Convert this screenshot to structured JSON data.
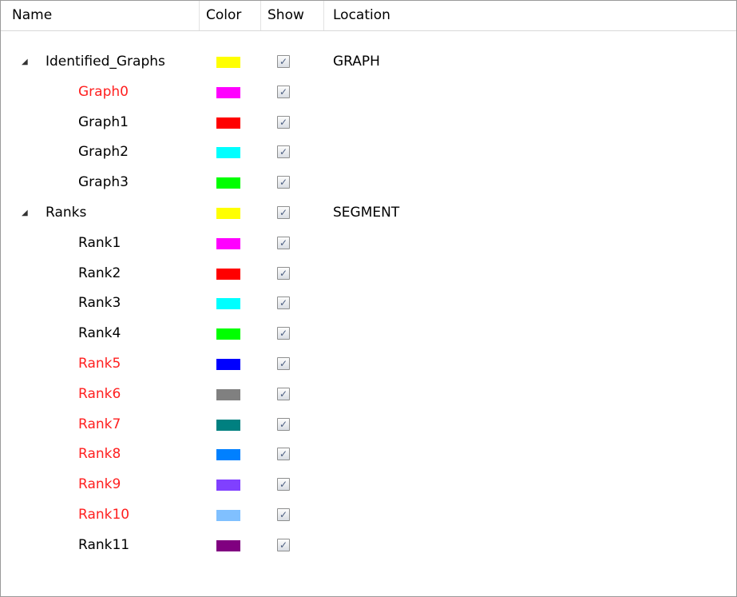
{
  "columns": {
    "name": "Name",
    "color": "Color",
    "show": "Show",
    "location": "Location"
  },
  "expander_glyph": "◢",
  "check_glyph": "✓",
  "rows": [
    {
      "name": "Identified_Graphs",
      "level": 0,
      "expanded": true,
      "color": "#ffff00",
      "show": true,
      "location": "GRAPH",
      "error": false
    },
    {
      "name": "Graph0",
      "level": 1,
      "color": "#ff00ff",
      "show": true,
      "location": "",
      "error": true
    },
    {
      "name": "Graph1",
      "level": 1,
      "color": "#ff0000",
      "show": true,
      "location": "",
      "error": false
    },
    {
      "name": "Graph2",
      "level": 1,
      "color": "#00ffff",
      "show": true,
      "location": "",
      "error": false
    },
    {
      "name": "Graph3",
      "level": 1,
      "color": "#00ff00",
      "show": true,
      "location": "",
      "error": false
    },
    {
      "name": "Ranks",
      "level": 0,
      "expanded": true,
      "color": "#ffff00",
      "show": true,
      "location": "SEGMENT",
      "error": false
    },
    {
      "name": "Rank1",
      "level": 1,
      "color": "#ff00ff",
      "show": true,
      "location": "",
      "error": false
    },
    {
      "name": "Rank2",
      "level": 1,
      "color": "#ff0000",
      "show": true,
      "location": "",
      "error": false
    },
    {
      "name": "Rank3",
      "level": 1,
      "color": "#00ffff",
      "show": true,
      "location": "",
      "error": false
    },
    {
      "name": "Rank4",
      "level": 1,
      "color": "#00ff00",
      "show": true,
      "location": "",
      "error": false
    },
    {
      "name": "Rank5",
      "level": 1,
      "color": "#0000ff",
      "show": true,
      "location": "",
      "error": true
    },
    {
      "name": "Rank6",
      "level": 1,
      "color": "#808080",
      "show": true,
      "location": "",
      "error": true
    },
    {
      "name": "Rank7",
      "level": 1,
      "color": "#008080",
      "show": true,
      "location": "",
      "error": true
    },
    {
      "name": "Rank8",
      "level": 1,
      "color": "#0080ff",
      "show": true,
      "location": "",
      "error": true
    },
    {
      "name": "Rank9",
      "level": 1,
      "color": "#8040ff",
      "show": true,
      "location": "",
      "error": true
    },
    {
      "name": "Rank10",
      "level": 1,
      "color": "#80c0ff",
      "show": true,
      "location": "",
      "error": true
    },
    {
      "name": "Rank11",
      "level": 1,
      "color": "#800080",
      "show": true,
      "location": "",
      "error": false
    }
  ]
}
